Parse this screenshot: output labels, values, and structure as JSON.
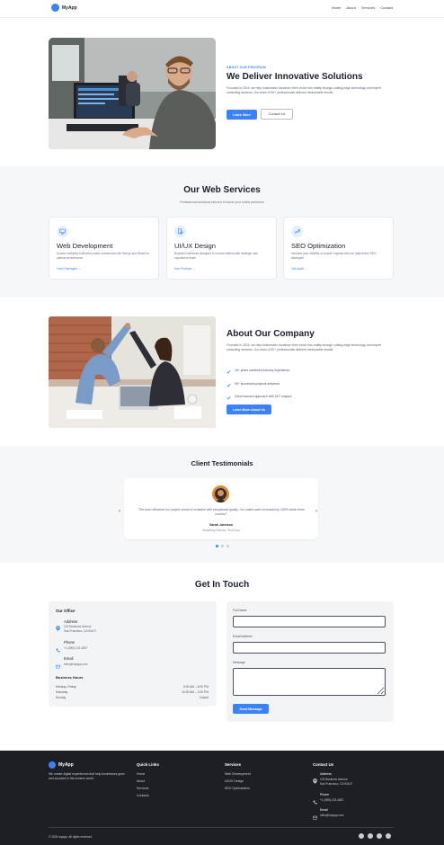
{
  "colors": {
    "accent": "#3b82f6",
    "footer_bg": "#1d1f24",
    "band_bg": "#f6f7f9"
  },
  "nav": {
    "brand": "MyApp",
    "links": [
      "Home",
      "About",
      "Services",
      "Contact"
    ]
  },
  "hero": {
    "eyebrow": "ABOUT OUR PROGRAM",
    "title": "We Deliver Innovative Solutions",
    "paragraph": "Founded in 2024, we help businesses transform their vision into reality through cutting-edge technology and expert consulting services. Our team of 50+ professionals delivers measurable results.",
    "primary_button": "Learn More",
    "secondary_button": "Contact Us"
  },
  "services": {
    "title": "Our Web Services",
    "subtitle": "Professional solutions tailored to boost your online presence",
    "cards": [
      {
        "icon": "monitor-icon",
        "title": "Web Development",
        "desc": "Custom websites built with modern frameworks like Next.js and React for optimal performance.",
        "link": "View Packages →"
      },
      {
        "icon": "design-tools-icon",
        "title": "UI/UX Design",
        "desc": "Beautiful interfaces designed to convert visitors with strategic user experience flows.",
        "link": "See Portfolio →"
      },
      {
        "icon": "trend-chart-icon",
        "title": "SEO Optimization",
        "desc": "Increase your visibility on search engines with our data-driven SEO strategies.",
        "link": "Get Audit →"
      }
    ]
  },
  "about": {
    "title": "About Our Company",
    "paragraph": "Founded in 2024, we help businesses transform their vision into reality through cutting-edge technology and expert consulting services. Our team of 50+ professionals delivers measurable results.",
    "checks": [
      "15+ years combined industry experience",
      "90+ successful projects delivered",
      "Client-focused approach with 24/7 support"
    ],
    "button": "Learn More About Us"
  },
  "testimonials": {
    "title": "Client Testimonials",
    "quote": "\"The team delivered our project ahead of schedule with exceptional quality. Our online sales increased by 150% within three months!\"",
    "name": "Sarah Johnson",
    "role": "Marketing Director, TechCorp",
    "prev": "‹",
    "next": "›",
    "active_dot": 1,
    "dot_count": 3
  },
  "contact": {
    "title": "Get In Touch",
    "office": {
      "heading": "Our Office",
      "address_label": "Address",
      "address_line1": "123 Business Avenue",
      "address_line2": "San Francisco, CA 94107",
      "phone_label": "Phone",
      "phone": "+1 (555) 123-4567",
      "email_label": "Email",
      "email": "hello@myapp.com",
      "hours_heading": "Business Hours",
      "hours": [
        {
          "day": "Monday–Friday",
          "time": "9:00 AM – 6:00 PM"
        },
        {
          "day": "Saturday",
          "time": "10:00 AM – 2:00 PM"
        },
        {
          "day": "Sunday",
          "time": "Closed"
        }
      ]
    },
    "form": {
      "name_label": "Full Name",
      "email_label": "Email Address",
      "message_label": "Message",
      "submit": "Send Message"
    }
  },
  "footer": {
    "brand": "MyApp",
    "tagline": "We create digital experiences that help businesses grow and succeed in the modern world.",
    "quick_links_heading": "Quick Links",
    "quick_links": [
      "Home",
      "About",
      "Services",
      "Contacts"
    ],
    "services_heading": "Services",
    "services": [
      "Web Development",
      "UI/UX Design",
      "SEO Optimization"
    ],
    "contact_heading": "Contact Us",
    "address_label": "Address",
    "address_line1": "123 Business Avenue",
    "address_line2": "San Francisco, CA 94107",
    "phone_label": "Phone",
    "phone": "+1 (555) 123-4567",
    "email_label": "Email",
    "email": "hello@myapp.com",
    "copyright": "© 2025 myapp. All rights reserved."
  }
}
